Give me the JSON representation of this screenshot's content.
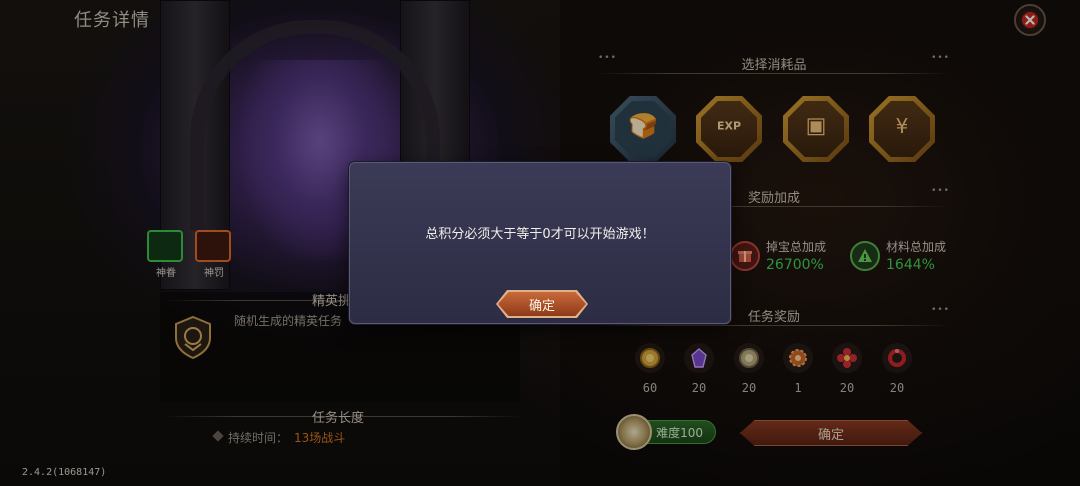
{
  "header": {
    "title": "任务详情"
  },
  "consumables": {
    "title": "选择消耗品",
    "items": [
      {
        "icon": "bread-icon",
        "count": ""
      },
      {
        "icon": "exp-card-icon",
        "count": ""
      },
      {
        "icon": "chest-card-icon",
        "count": ""
      },
      {
        "icon": "gold-card-icon",
        "count": ""
      }
    ]
  },
  "bonus": {
    "title": "奖励加成",
    "items": [
      {
        "icon": "loot-bonus-icon",
        "label": "掉宝总加成",
        "value": "26700%"
      },
      {
        "icon": "material-bonus-icon",
        "label": "材料总加成",
        "value": "1644%"
      }
    ]
  },
  "rewards": {
    "title": "任务奖励",
    "items": [
      {
        "icon": "gold-coin-icon",
        "qty": "60"
      },
      {
        "icon": "purple-gem-icon",
        "qty": "20"
      },
      {
        "icon": "silver-coin-icon",
        "qty": "20"
      },
      {
        "icon": "bronze-medal-icon",
        "qty": "1"
      },
      {
        "icon": "red-flower-icon",
        "qty": "20"
      },
      {
        "icon": "red-ring-icon",
        "qty": "20"
      }
    ]
  },
  "difficulty": {
    "label": "难度100"
  },
  "confirm_main": {
    "label": "确定"
  },
  "emblems": [
    {
      "label": "神眷",
      "color": "#3fbf4a"
    },
    {
      "label": "神罚",
      "color": "#e06a2a"
    }
  ],
  "elite": {
    "title": "精英挑战",
    "description": "随机生成的精英任务"
  },
  "duration": {
    "title": "任务长度",
    "label": "持续时间：",
    "value": "13场战斗"
  },
  "version": "2.4.2(1068147)",
  "modal": {
    "message": "总积分必须大于等于0才可以开始游戏！",
    "button": "确定"
  }
}
